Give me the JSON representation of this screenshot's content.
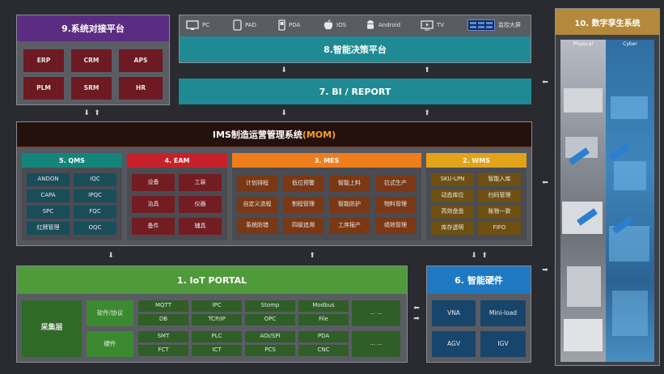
{
  "colors": {
    "bg": "#2a2b30",
    "panel": "#5a5c63",
    "purple": "#5b2d82",
    "teal": "#1f8a93",
    "red": "#c8202a",
    "orange": "#ef7d1b",
    "gold": "#e2a21a",
    "green": "#4f9a3b",
    "blue": "#1e78c2",
    "mom_highlight": "#f7a21b",
    "twin_title": "#b5893c"
  },
  "system_integration": {
    "title": "9.系统对接平台",
    "items": [
      "ERP",
      "CRM",
      "APS",
      "PLM",
      "SRM",
      "HR"
    ]
  },
  "devices": [
    {
      "label": "PC",
      "icon": "monitor-icon"
    },
    {
      "label": "PAD",
      "icon": "tablet-icon"
    },
    {
      "label": "PDA",
      "icon": "pda-icon"
    },
    {
      "label": "IOS",
      "icon": "apple-icon"
    },
    {
      "label": "Android",
      "icon": "android-icon"
    },
    {
      "label": "TV",
      "icon": "tv-icon"
    },
    {
      "label": "监控大屏",
      "icon": "big-screen-icon"
    }
  ],
  "decision_platform": {
    "title": "8.智能决策平台"
  },
  "bi_report": {
    "title": "7. BI / REPORT"
  },
  "mom": {
    "title_prefix": "IMS制造运营管理系统",
    "title_highlight": "(MOM)"
  },
  "modules": {
    "qms": {
      "title": "5. QMS",
      "items": [
        "ANDON",
        "IQC",
        "CAPA",
        "IPQC",
        "SPC",
        "FQC",
        "红牌管理",
        "OQC"
      ]
    },
    "eam": {
      "title": "4. EAM",
      "items": [
        "设备",
        "工装",
        "治具",
        "仪器",
        "备件",
        "辅具"
      ]
    },
    "mes": {
      "title": "3. MES",
      "items": [
        "计划排程",
        "低位预警",
        "智能上料",
        "拉式生产",
        "自定义流程",
        "制程管理",
        "智能防护",
        "物料管理",
        "系统防错",
        "四级追溯",
        "工序报产",
        "绩效管理"
      ]
    },
    "wms": {
      "title": "2. WMS",
      "items": [
        "SKU-LPN",
        "智能入库",
        "动态库位",
        "扫码管理",
        "高效盘盘",
        "账物一致",
        "库存透明",
        "FIFO"
      ]
    }
  },
  "iot": {
    "title": "1. IoT PORTAL",
    "layer": "采集层",
    "rows": [
      {
        "category": "软件/协议",
        "lines": [
          [
            "MQTT",
            "IPC",
            "Stomp",
            "Modbus",
            "... ..."
          ],
          [
            "DB",
            "TCP/IP",
            "OPC",
            "File"
          ]
        ]
      },
      {
        "category": "硬件",
        "lines": [
          [
            "SMT",
            "PLC",
            "AOI/SPI",
            "PDA",
            "... ..."
          ],
          [
            "FCT",
            "ICT",
            "PCS",
            "CNC"
          ]
        ]
      }
    ]
  },
  "smart_hardware": {
    "title": "6. 智能硬件",
    "items": [
      "VNA",
      "Mini-load",
      "AGV",
      "IGV"
    ]
  },
  "digital_twin": {
    "title": "10. 数字孪生系统",
    "physical_label": "Physical",
    "cyber_label": "Cyber"
  }
}
